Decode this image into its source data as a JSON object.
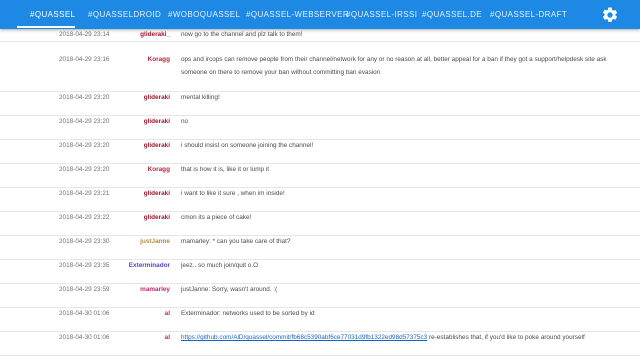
{
  "tabs": [
    {
      "label": "#QUASSEL",
      "active": true
    },
    {
      "label": "#QUASSELDROID",
      "active": false
    },
    {
      "label": "#WOBOQUASSEL",
      "active": false
    },
    {
      "label": "#QUASSEL-WEBSERVER",
      "active": false
    },
    {
      "label": "#QUASSEL-IRSSI",
      "active": false
    },
    {
      "label": "#QUASSEL.DE",
      "active": false
    },
    {
      "label": "#QUASSEL-DRAFT",
      "active": false
    }
  ],
  "settings_icon": "gear-icon",
  "colors": {
    "header": "#1e88e5",
    "link": "#1565c0"
  },
  "messages": [
    {
      "time": "2018-04-29 23:14",
      "nick": "glideraki_",
      "nick_color": "#a01830",
      "text": "now go to the channel and plz talk to them!"
    },
    {
      "time": "2018-04-29 23:16",
      "nick": "Koragg",
      "nick_color": "#b8243a",
      "text": "ops and ircops can remove people from their channel/network for any or no reason at all, better appeal for a ban if they got a support/helpdesk site ask someone on there to remove your ban without committing ban evasion"
    },
    {
      "time": "2018-04-29 23:20",
      "nick": "glideraki",
      "nick_color": "#a01830",
      "text": "mental killing!"
    },
    {
      "time": "2018-04-29 23:20",
      "nick": "glideraki",
      "nick_color": "#a01830",
      "text": "no"
    },
    {
      "time": "2018-04-29 23:20",
      "nick": "glideraki",
      "nick_color": "#a01830",
      "text": "i should insist on someone joining the channel!"
    },
    {
      "time": "2018-04-29 23:20",
      "nick": "Koragg",
      "nick_color": "#b8243a",
      "text": "that is how it is, like it or lump it"
    },
    {
      "time": "2018-04-29 23:21",
      "nick": "glideraki",
      "nick_color": "#a01830",
      "text": "i want to like it sure , when im inside!"
    },
    {
      "time": "2018-04-29 23:22",
      "nick": "glideraki",
      "nick_color": "#a01830",
      "text": "cmon its a piece of cake!"
    },
    {
      "time": "2018-04-29 23:30",
      "nick": "justJanne",
      "nick_color": "#b98a3c",
      "text": "mamarley: * can you take care of that?"
    },
    {
      "time": "2018-04-29 23:35",
      "nick": "Exterminador",
      "nick_color": "#5b3fc8",
      "text": "jeez.. so much join/quit o.O"
    },
    {
      "time": "2018-04-29 23:59",
      "nick": "mamarley",
      "nick_color": "#c0286e",
      "text": "justJanne: Sorry, wasn't around. :("
    },
    {
      "time": "2018-04-30 01:06",
      "nick": "al",
      "nick_color": "#c0286e",
      "text": "Exterminador: networks used to be sorted by id"
    },
    {
      "time": "2018-04-30 01:06",
      "nick": "al",
      "nick_color": "#c0286e",
      "link": "https://github.com/AlD/quassel/commit/fb68c5390abf6ce77031d9fb1322ed98d57375c3",
      "text": " re-establishes that, if you'd like to poke around yourself"
    }
  ]
}
